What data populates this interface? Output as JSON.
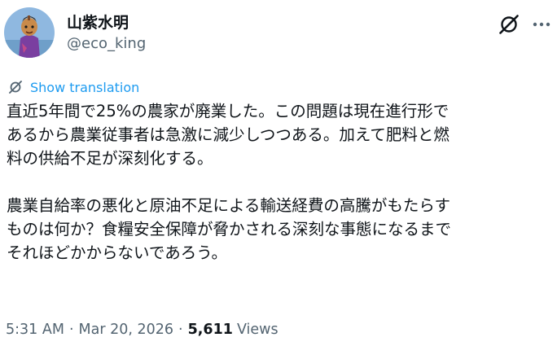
{
  "author": {
    "name": "山紫水明",
    "handle": "@eco_king"
  },
  "header": {
    "grok_icon": "grok-icon",
    "more_icon": "more-icon"
  },
  "translate": {
    "label": "Show translation",
    "icon": "translate-icon"
  },
  "post": {
    "lines": [
      "直近5年間で25%の農家が廃業した。この問題は現在進行形で",
      "あるから農業従事者は急激に減少しつつある。加えて肥料と燃",
      "料の供給不足が深刻化する。",
      "",
      "農業自給率の悪化と原油不足による輸送経費の高騰がもたらす",
      "ものは何か？食糧安全保障が脅かされる深刻な事態になるまで",
      "それほどかからないであろう。"
    ]
  },
  "meta": {
    "time": "5:31 AM",
    "separator": "·",
    "date": "Mar 20, 2026",
    "views_count": "5,611",
    "views_label": "Views"
  },
  "colors": {
    "text": "#0f1419",
    "secondary": "#536471",
    "link": "#1d9bf0"
  }
}
